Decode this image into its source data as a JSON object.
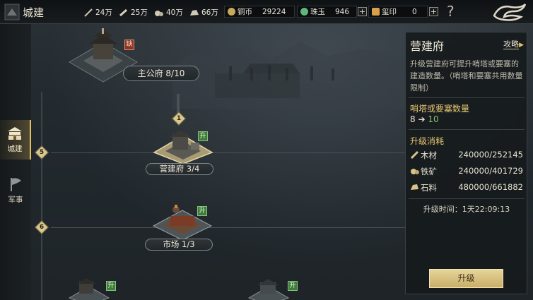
{
  "topbar": {
    "title": "城建",
    "resources": [
      {
        "name": "feather-icon",
        "value": "24万"
      },
      {
        "name": "scroll-icon",
        "value": "25万"
      },
      {
        "name": "ore-icon",
        "value": "40万"
      },
      {
        "name": "stone-icon",
        "value": "66万"
      }
    ],
    "currencies": [
      {
        "label": "铜币",
        "value": "29224",
        "color": "#c9a85a"
      },
      {
        "label": "珠玉",
        "value": "946",
        "color": "#5fb77a"
      },
      {
        "label": "玺印",
        "value": "0",
        "color": "#d9a04a"
      }
    ],
    "help": "?"
  },
  "leftnav": {
    "items": [
      {
        "label": "城建",
        "active": true
      },
      {
        "label": "军事",
        "active": false
      }
    ]
  },
  "map": {
    "main_building": {
      "label": "主公府 8/10",
      "badge": "缺"
    },
    "levels": [
      {
        "num": "1"
      },
      {
        "num": "5"
      },
      {
        "num": "6"
      }
    ],
    "buildings": [
      {
        "label": "营建府 3/4",
        "badge": "升"
      },
      {
        "label": "市场 1/3",
        "badge": "升"
      },
      {
        "label": "",
        "badge": "升"
      },
      {
        "label": "",
        "badge": "升"
      }
    ]
  },
  "panel": {
    "title": "营建府",
    "guide": "攻略",
    "desc": "升级营建府可提升哨塔或要塞的建造数量。（哨塔和要塞共用数量限制）",
    "stat_label": "哨塔或要塞数量",
    "stat_from": "8",
    "stat_arrow": "➔",
    "stat_to": "10",
    "cost_label": "升级消耗",
    "costs": [
      {
        "name": "木材",
        "value": "240000/252145"
      },
      {
        "name": "铁矿",
        "value": "240000/401729"
      },
      {
        "name": "石料",
        "value": "480000/661882"
      }
    ],
    "time": "升级时间：1天22:09:13",
    "upgrade": "升级"
  }
}
